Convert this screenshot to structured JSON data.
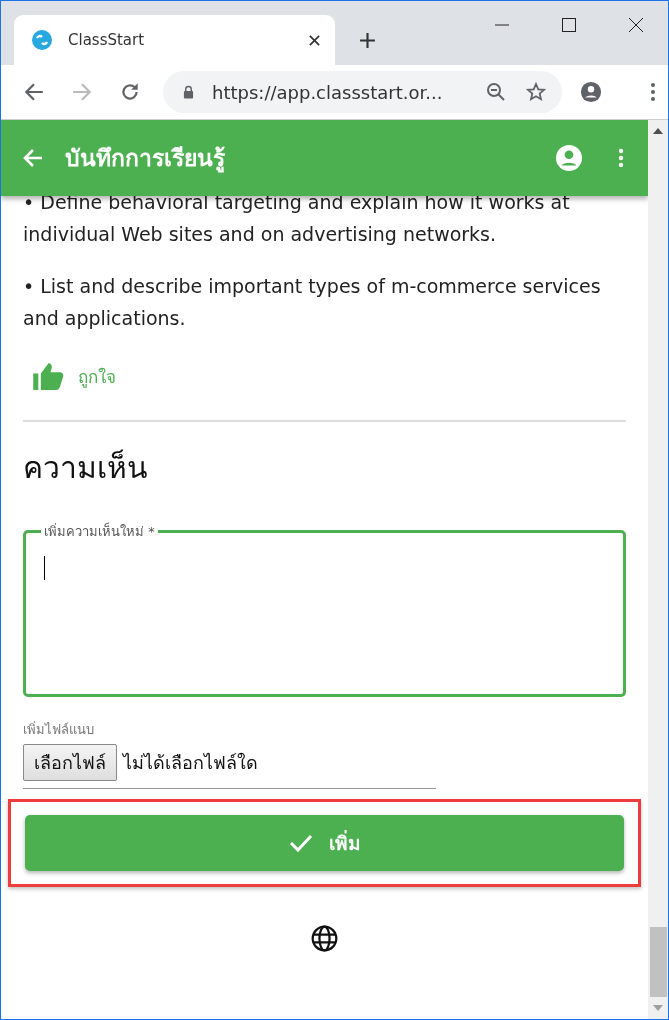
{
  "browser": {
    "tab": {
      "title": "ClassStart"
    },
    "url": "https://app.classstart.or..."
  },
  "app_bar": {
    "title": "บันทึกการเรียนรู้"
  },
  "objectives": [
    "• Define behavioral targeting and explain how it works at individual Web sites and on advertising networks.",
    "• List and describe important types of m-commerce services and applications."
  ],
  "like": {
    "label": "ถูกใจ"
  },
  "comments": {
    "heading": "ความเห็น",
    "field": {
      "label": "เพิ่มความเห็นใหม่ *",
      "focused": true
    },
    "attachment": {
      "label": "เพิ่มไฟล์แนบ",
      "button": "เลือกไฟล์",
      "status": "ไม่ได้เลือกไฟล์ใด"
    },
    "submit": {
      "label": "เพิ่ม",
      "highlighted": true
    }
  }
}
